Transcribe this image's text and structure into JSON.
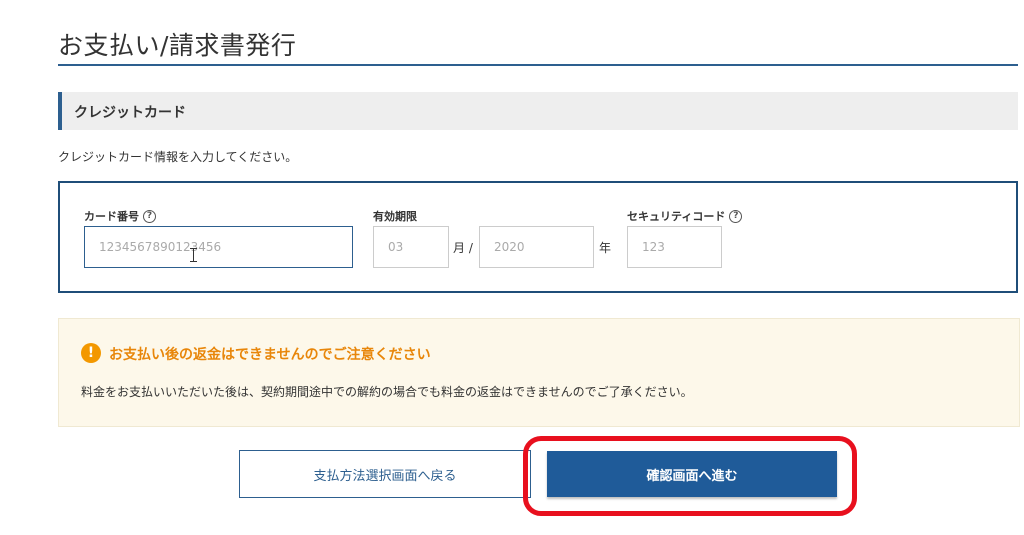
{
  "page": {
    "title": "お支払い/請求書発行"
  },
  "section": {
    "heading": "クレジットカード"
  },
  "instruction": "クレジットカード情報を入力してください。",
  "card_form": {
    "card_number": {
      "label": "カード番号",
      "help_glyph": "?",
      "placeholder": "1234567890123456",
      "value": ""
    },
    "expiry": {
      "label": "有効期限",
      "month": {
        "placeholder": "03",
        "value": "",
        "unit": "月 /"
      },
      "year": {
        "placeholder": "2020",
        "value": "",
        "unit": "年"
      }
    },
    "security_code": {
      "label": "セキュリティコード",
      "help_glyph": "?",
      "placeholder": "123",
      "value": ""
    }
  },
  "notice": {
    "icon_glyph": "!",
    "title": "お支払い後の返金はできませんのでご注意ください",
    "body": "料金をお支払いいただいた後は、契約期間途中での解約の場合でも料金の返金はできませんのでご了承ください。"
  },
  "buttons": {
    "back_label": "支払方法選択画面へ戻る",
    "confirm_label": "確認画面へ進む"
  },
  "colors": {
    "accent": "#1f5b99",
    "notice_text": "#e8860a",
    "notice_icon": "#f39800",
    "highlight": "#e8101e"
  },
  "icons": {
    "help": "question-circle-icon",
    "notice": "exclamation-circle-icon",
    "cursor": "text-cursor-icon"
  }
}
